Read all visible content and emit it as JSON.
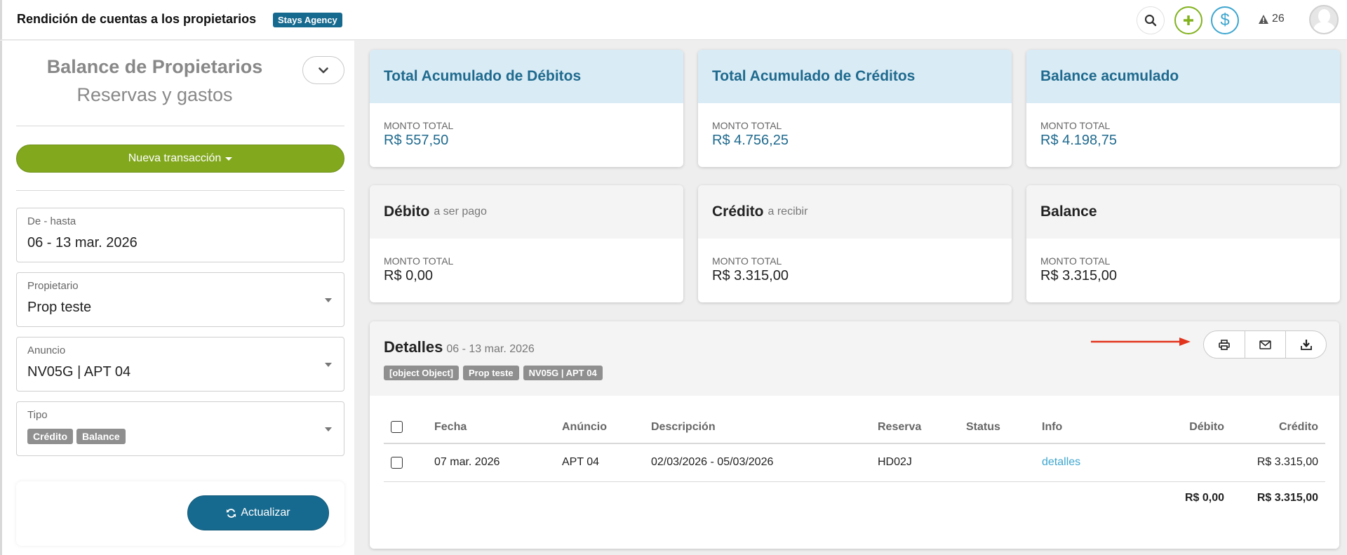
{
  "header": {
    "title": "Rendición de cuentas a los propietarios",
    "agency_badge": "Stays Agency",
    "alert_count": "26"
  },
  "sidebar": {
    "title": "Balance de Propietarios",
    "subtitle": "Reservas y gastos",
    "new_transaction_label": "Nueva transacción",
    "date_field": {
      "label": "De - hasta",
      "value": "06 - 13 mar. 2026"
    },
    "owner_field": {
      "label": "Propietario",
      "value": "Prop teste"
    },
    "listing_field": {
      "label": "Anuncio",
      "value": "NV05G | APT 04"
    },
    "type_field": {
      "label": "Tipo",
      "tags": [
        "Crédito",
        "Balance"
      ]
    },
    "update_label": "Actualizar"
  },
  "summary_cards": [
    {
      "title": "Total Acumulado de Débitos",
      "subtitle": "",
      "amount_label": "MONTO TOTAL",
      "amount": "R$ 557,50"
    },
    {
      "title": "Total Acumulado de Créditos",
      "subtitle": "",
      "amount_label": "MONTO TOTAL",
      "amount": "R$ 4.756,25"
    },
    {
      "title": "Balance acumulado",
      "subtitle": "",
      "amount_label": "MONTO TOTAL",
      "amount": "R$ 4.198,75"
    },
    {
      "title": "Débito",
      "subtitle": "a ser pago",
      "amount_label": "MONTO TOTAL",
      "amount": "R$ 0,00"
    },
    {
      "title": "Crédito",
      "subtitle": "a recibir",
      "amount_label": "MONTO TOTAL",
      "amount": "R$ 3.315,00"
    },
    {
      "title": "Balance",
      "subtitle": "",
      "amount_label": "MONTO TOTAL",
      "amount": "R$ 3.315,00"
    }
  ],
  "details": {
    "title": "Detalles",
    "range": "06 - 13 mar. 2026",
    "tags": [
      "[object Object]",
      "Prop teste",
      "NV05G | APT 04"
    ],
    "columns": [
      "Fecha",
      "Anúncio",
      "Descripción",
      "Reserva",
      "Status",
      "Info",
      "Débito",
      "Crédito"
    ],
    "rows": [
      {
        "fecha": "07 mar. 2026",
        "anuncio": "APT 04",
        "descripcion": "02/03/2026 - 05/03/2026",
        "reserva": "HD02J",
        "status": "",
        "info": "detalles",
        "debito": "",
        "credito": "R$ 3.315,00"
      }
    ],
    "totals": {
      "debito": "R$ 0,00",
      "credito": "R$ 3.315,00"
    }
  },
  "colors": {
    "brand_blue": "#176a8f",
    "accent_green": "#82a81e",
    "light_blue": "#3ea6cf",
    "arrow_red": "#e2341d"
  },
  "icons": [
    "search-icon",
    "plus-icon",
    "dollar-icon",
    "alert-icon",
    "avatar-icon",
    "chevron-down-icon",
    "refresh-icon",
    "print-icon",
    "email-icon",
    "download-icon"
  ]
}
